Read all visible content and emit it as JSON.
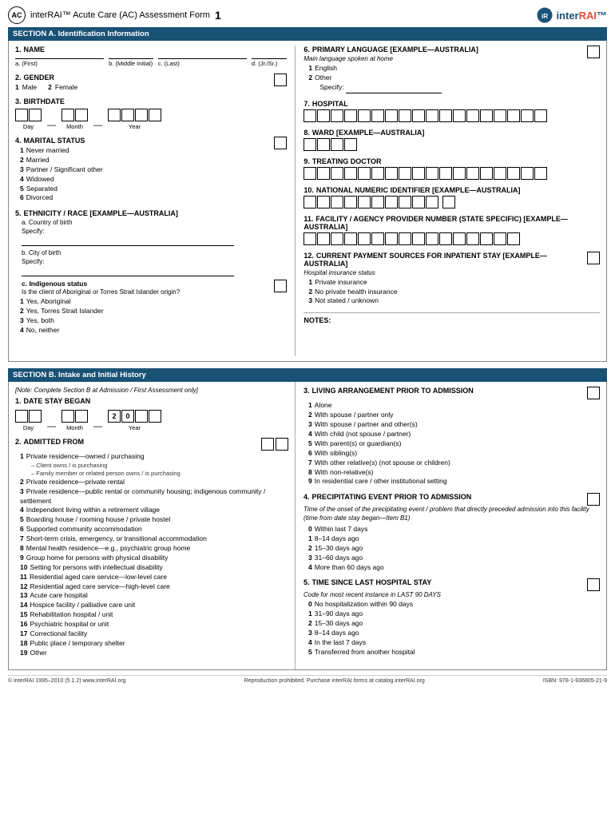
{
  "header": {
    "badge": "AC",
    "title": "interRAI™ Acute Care (AC) Assessment Form",
    "page_number": "1",
    "logo": "interRAI™"
  },
  "section_a": {
    "title": "SECTION A. Identification Information",
    "items_left": [
      {
        "num": "1.",
        "label": "NAME",
        "type": "name_fields",
        "fields": [
          "a. (First)",
          "b. (Middle Initial)",
          "c. (Last)",
          "d. (Jr./Sr.)"
        ]
      },
      {
        "num": "2.",
        "label": "GENDER",
        "type": "gender",
        "options": [
          {
            "num": "1",
            "text": "Male"
          },
          {
            "num": "2",
            "text": "Female"
          }
        ]
      },
      {
        "num": "3.",
        "label": "BIRTHDATE",
        "type": "birthdate",
        "groups": [
          "Day",
          "Month",
          "Year"
        ],
        "day_boxes": 2,
        "month_boxes": 2,
        "year_boxes": 4
      },
      {
        "num": "4.",
        "label": "MARITAL STATUS",
        "type": "list_checkbox",
        "options": [
          {
            "num": "1",
            "text": "Never married"
          },
          {
            "num": "2",
            "text": "Married"
          },
          {
            "num": "3",
            "text": "Partner / Significant other"
          },
          {
            "num": "4",
            "text": "Widowed"
          },
          {
            "num": "5",
            "text": "Separated"
          },
          {
            "num": "6",
            "text": "Divorced"
          }
        ]
      },
      {
        "num": "5.",
        "label": "ETHNICITY / RACE [EXAMPLE—AUSTRALIA]",
        "type": "ethnicity",
        "sub_a": "a. Country of birth",
        "sub_b": "b. City of birth",
        "sub_c": "c. Indigenous status",
        "indigenous_text": "Is the client of Aboriginal or Torres Strait Islander origin?",
        "indigenous_options": [
          {
            "num": "1",
            "text": "Yes, Aboriginal"
          },
          {
            "num": "2",
            "text": "Yes, Torres Strait Islander"
          },
          {
            "num": "3",
            "text": "Yes, both"
          },
          {
            "num": "4",
            "text": "No, neither"
          }
        ]
      }
    ],
    "items_right": [
      {
        "num": "6.",
        "label": "PRIMARY LANGUAGE [EXAMPLE—AUSTRALIA]",
        "sub": "Main language spoken at home",
        "type": "list_checkbox",
        "options": [
          {
            "num": "1",
            "text": "English"
          },
          {
            "num": "2",
            "text": "Other"
          },
          {
            "num": "",
            "text": "Specify: ___________________________"
          }
        ],
        "boxes": 0
      },
      {
        "num": "7.",
        "label": "HOSPITAL",
        "type": "boxes",
        "box_count": 18
      },
      {
        "num": "8.",
        "label": "WARD [EXAMPLE—AUSTRALIA]",
        "type": "boxes",
        "box_count": 4
      },
      {
        "num": "9.",
        "label": "TREATING DOCTOR",
        "type": "boxes",
        "box_count": 18
      },
      {
        "num": "10.",
        "label": "NATIONAL NUMERIC IDENTIFIER [EXAMPLE—AUSTRALIA]",
        "type": "boxes",
        "box_count": 10
      },
      {
        "num": "11.",
        "label": "FACILITY / AGENCY PROVIDER NUMBER (STATE SPECIFIC) [EXAMPLE—AUSTRALIA]",
        "type": "boxes",
        "box_count": 16
      },
      {
        "num": "12.",
        "label": "CURRENT PAYMENT SOURCES FOR INPATIENT STAY [EXAMPLE—AUSTRALIA]",
        "sub": "Hospital insurance status",
        "type": "list_checkbox",
        "options": [
          {
            "num": "1",
            "text": "Private insurance"
          },
          {
            "num": "2",
            "text": "No private health insurance"
          },
          {
            "num": "3",
            "text": "Not stated / unknown"
          }
        ]
      }
    ],
    "notes_label": "NOTES:"
  },
  "section_b": {
    "title": "SECTION B. Intake and Initial History",
    "note": "[Note: Complete Section B at Admission / First Assessment only]",
    "items_left": [
      {
        "num": "1.",
        "label": "DATE STAY BEGAN",
        "type": "date_stay",
        "day_boxes": 2,
        "month_boxes": 2,
        "year_prefill": "2 0",
        "year_boxes": 2,
        "labels": [
          "Day",
          "Month",
          "Year"
        ]
      },
      {
        "num": "2.",
        "label": "ADMITTED FROM",
        "type": "list_checkbox_long",
        "options": [
          {
            "num": "1",
            "text": "Private residence—owned / purchasing",
            "subs": [
              "– Client owns / is purchasing",
              "– Family member or related person owns / is purchasing"
            ]
          },
          {
            "num": "2",
            "text": "Private residence—private rental"
          },
          {
            "num": "3",
            "text": "Private residence—public rental or community housing; indigenous community / settlement"
          },
          {
            "num": "4",
            "text": "Independent living within a retirement village"
          },
          {
            "num": "5",
            "text": "Boarding house / rooming house / private hostel"
          },
          {
            "num": "6",
            "text": "Supported community accommodation"
          },
          {
            "num": "7",
            "text": "Short-term crisis, emergency, or transitional accommodation"
          },
          {
            "num": "8",
            "text": "Mental health residence—e.g., psychiatric group home"
          },
          {
            "num": "9",
            "text": "Group home for persons with physical disability"
          },
          {
            "num": "10",
            "text": "Setting for persons with intellectual disability"
          },
          {
            "num": "11",
            "text": "Residential aged care service—low-level care"
          },
          {
            "num": "12",
            "text": "Residential aged care service—high-level care"
          },
          {
            "num": "13",
            "text": "Acute care hospital"
          },
          {
            "num": "14",
            "text": "Hospice facility / palliative care unit"
          },
          {
            "num": "15",
            "text": "Rehabilitation hospital / unit"
          },
          {
            "num": "16",
            "text": "Psychiatric hospital or unit"
          },
          {
            "num": "17",
            "text": "Correctional facility"
          },
          {
            "num": "18",
            "text": "Public place / temporary shelter"
          },
          {
            "num": "19",
            "text": "Other"
          }
        ]
      }
    ],
    "items_right": [
      {
        "num": "3.",
        "label": "LIVING ARRANGEMENT PRIOR TO ADMISSION",
        "type": "list_checkbox",
        "options": [
          {
            "num": "1",
            "text": "Alone"
          },
          {
            "num": "2",
            "text": "With spouse / partner only"
          },
          {
            "num": "3",
            "text": "With spouse / partner and other(s)"
          },
          {
            "num": "4",
            "text": "With child (not spouse / partner)"
          },
          {
            "num": "5",
            "text": "With parent(s) or guardian(s)"
          },
          {
            "num": "6",
            "text": "With sibling(s)"
          },
          {
            "num": "7",
            "text": "With other relative(s) (not spouse or children)"
          },
          {
            "num": "8",
            "text": "With non-relative(s)"
          },
          {
            "num": "9",
            "text": "In residential care / other institutional setting"
          }
        ]
      },
      {
        "num": "4.",
        "label": "PRECIPITATING EVENT PRIOR TO ADMISSION",
        "type": "list_checkbox",
        "note": "Time of the onset of the precipitating event / problem that directly preceded admission into this facility (time from date stay began—Item B1)",
        "options": [
          {
            "num": "0",
            "text": "Within last 7 days"
          },
          {
            "num": "1",
            "text": "8–14 days ago"
          },
          {
            "num": "2",
            "text": "15–30 days ago"
          },
          {
            "num": "3",
            "text": "31–60 days ago"
          },
          {
            "num": "4",
            "text": "More than 60 days ago"
          }
        ]
      },
      {
        "num": "5.",
        "label": "TIME SINCE LAST HOSPITAL STAY",
        "type": "list_checkbox",
        "note": "Code for most recent instance in LAST 90 DAYS",
        "options": [
          {
            "num": "0",
            "text": "No hospitalization within 90 days"
          },
          {
            "num": "1",
            "text": "31–90 days ago"
          },
          {
            "num": "2",
            "text": "15–30 days ago"
          },
          {
            "num": "3",
            "text": "8–14 days ago"
          },
          {
            "num": "4",
            "text": "In the last 7 days"
          },
          {
            "num": "5",
            "text": "Transferred from another hospital"
          }
        ]
      }
    ]
  },
  "footer": {
    "copyright": "© interRAI 1995–2010 (5.1.2)  www.interRAI.org",
    "middle": "Reproduction prohibited. Purchase interRAI forms at catalog.interRAI.org",
    "isbn": "ISBN: 978-1-936805-21-9"
  }
}
